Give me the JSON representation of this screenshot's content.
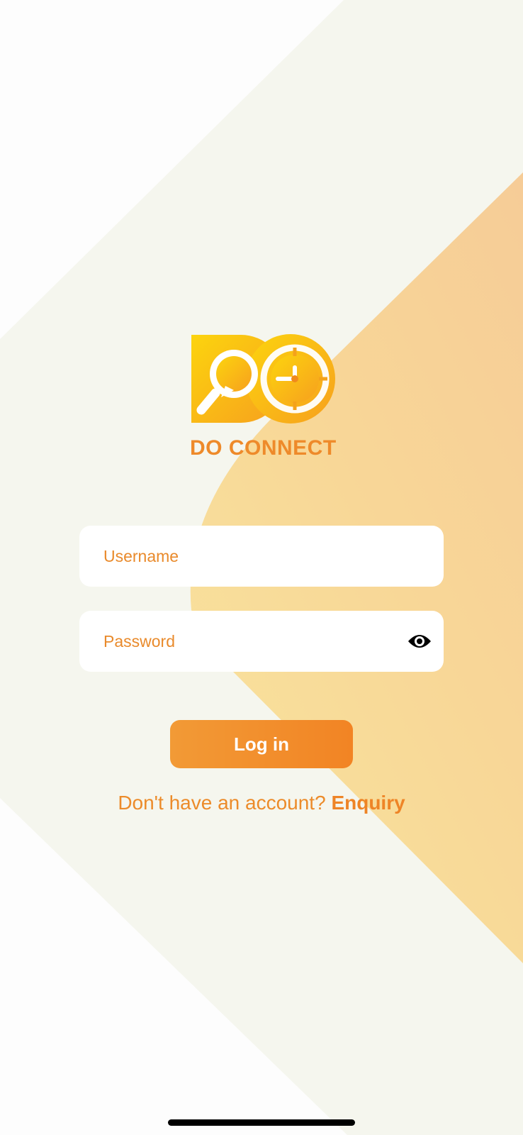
{
  "brand": {
    "name": "DO CONNECT",
    "logo_icon": "do-connect-logo"
  },
  "form": {
    "username_placeholder": "Username",
    "username_value": "",
    "password_placeholder": "Password",
    "password_value": "",
    "password_toggle_icon": "eye-icon",
    "login_label": "Log in"
  },
  "signup": {
    "prompt": "Don't have an account?",
    "link_label": "Enquiry"
  },
  "colors": {
    "accent": "#F28424",
    "text_orange": "#E98A2B",
    "background_light": "#F5F6EE",
    "gradient_yellow": "#F8E09A"
  }
}
